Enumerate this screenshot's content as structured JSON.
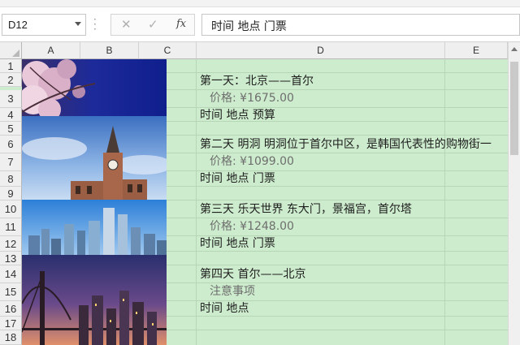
{
  "formula_bar": {
    "name_box": "D12",
    "fx_label": "fx",
    "cancel_symbol": "✕",
    "enter_symbol": "✓",
    "formula_text": "时间 地点 门票"
  },
  "columns": [
    "A",
    "B",
    "C",
    "D",
    "E"
  ],
  "rows": [
    "1",
    "2",
    "3",
    "4",
    "5",
    "6",
    "7",
    "8",
    "9",
    "10",
    "11",
    "12",
    "13",
    "14",
    "15",
    "16",
    "17",
    "18"
  ],
  "cells": {
    "d2": "第一天：北京——首尔",
    "d3": "价格: ¥1675.00",
    "d4": "时间 地点 预算",
    "d6": "第二天 明洞  明洞位于首尔中区，是韩国代表性的购物街一",
    "d7": "价格: ¥1099.00",
    "d8": "时间 地点 门票",
    "d10": "第三天 乐天世界 东大门，景福宫，首尔塔",
    "d11": "价格: ¥1248.00",
    "d12": "时间 地点 门票",
    "d14": "第四天 首尔——北京",
    "d15": "注意事项",
    "d16": "时间 地点"
  },
  "pictures": [
    {
      "name": "cherry-blossom-photo"
    },
    {
      "name": "clock-tower-photo"
    },
    {
      "name": "city-skyline-photo"
    },
    {
      "name": "bridge-night-photo"
    }
  ],
  "colors": {
    "sheet_background": "#cdeccd",
    "gridline": "#b6d6b6",
    "header_background": "#efefef"
  }
}
